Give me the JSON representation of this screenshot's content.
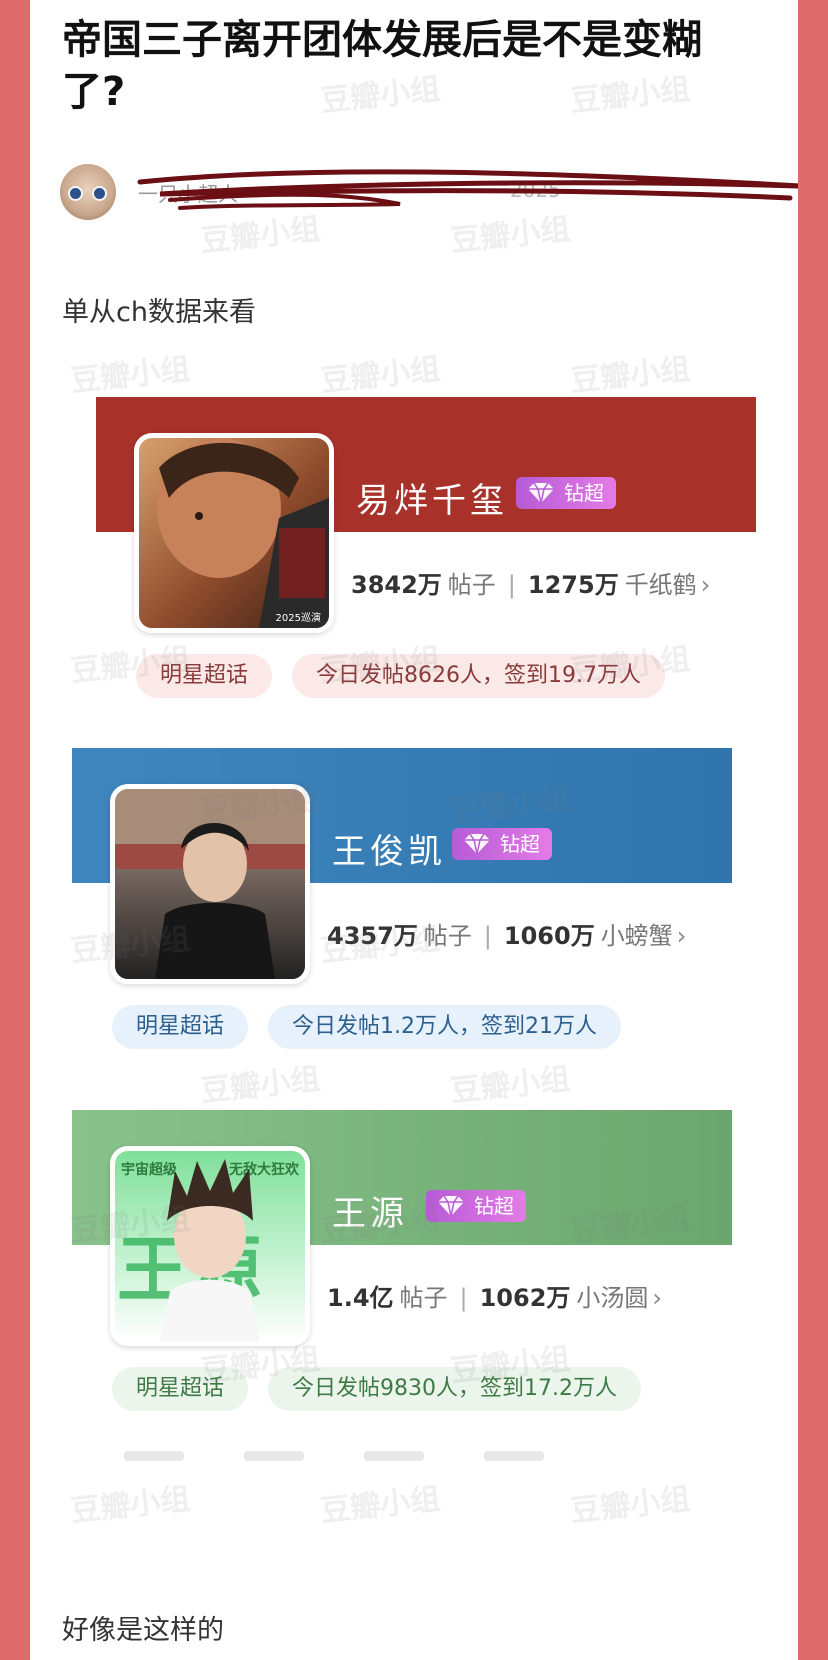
{
  "post": {
    "title": "帝国三子离开团体发展后是不是变糊了?",
    "author": "一只小超人",
    "date": "2025",
    "intro": "单从ch数据来看",
    "outro": "好像是这样的"
  },
  "cards": [
    {
      "name": "易烊千玺",
      "badge": "钻超",
      "posts": "3842万",
      "posts_unit": "帖子",
      "fans": "1275万",
      "fans_unit": "千纸鹤",
      "chip_label": "明星超话",
      "activity": "今日发帖8626人，签到19.7万人",
      "cover_text": "2025巡演"
    },
    {
      "name": "王俊凯",
      "badge": "钻超",
      "posts": "4357万",
      "posts_unit": "帖子",
      "fans": "1060万",
      "fans_unit": "小螃蟹",
      "chip_label": "明星超话",
      "activity": "今日发帖1.2万人，签到21万人"
    },
    {
      "name": "王源",
      "badge": "钻超",
      "posts": "1.4亿",
      "posts_unit": "帖子",
      "fans": "1062万",
      "fans_unit": "小汤圆",
      "chip_label": "明星超话",
      "activity": "今日发帖9830人，签到17.2万人",
      "cover_text": "王源",
      "cover_tags": [
        "宇宙超级",
        "无敌大狂欢"
      ]
    }
  ],
  "watermark": "豆瓣小组",
  "icons": {
    "gem": "diamond-gem-icon",
    "chevron": "chevron-right-icon"
  },
  "colors": {
    "frame": "#e06b6b",
    "card1": "#a8322a",
    "card2": "#3f86bf",
    "card3": "#8ac28c",
    "badge": "#c76bde"
  }
}
